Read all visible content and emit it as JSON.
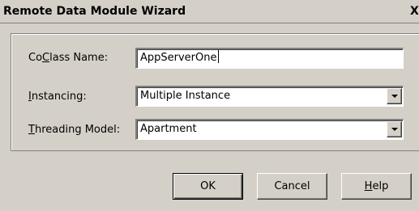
{
  "window": {
    "title": "Remote Data Module Wizard",
    "close_glyph": "X"
  },
  "form": {
    "coclass": {
      "label_pre": "Co",
      "label_accel": "C",
      "label_post": "lass Name:",
      "value": "AppServerOne"
    },
    "instancing": {
      "label_accel": "I",
      "label_post": "nstancing:",
      "value": "Multiple Instance"
    },
    "threading": {
      "label_accel": "T",
      "label_post": "hreading Model:",
      "value": "Apartment"
    }
  },
  "buttons": {
    "ok": "OK",
    "cancel": "Cancel",
    "help_accel": "H",
    "help_post": "elp"
  },
  "colors": {
    "face": "#d4d0c8",
    "field": "#ffffff",
    "shadow": "#808080"
  },
  "icons": {
    "close": "close-icon",
    "dropdown": "chevron-down-icon"
  }
}
